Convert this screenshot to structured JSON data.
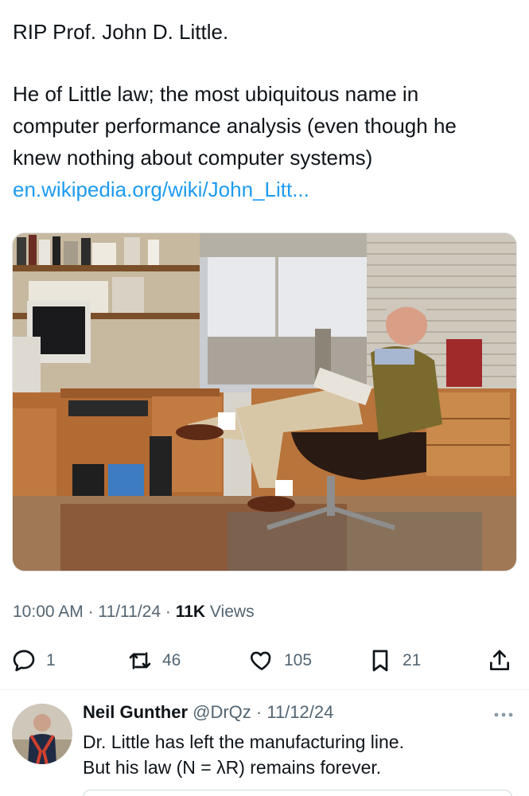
{
  "tweet": {
    "line1": "RIP Prof.  John D. Little.",
    "line2": "He of Little law; the most ubiquitous name in",
    "line3": "computer performance analysis (even though he",
    "line4": "knew nothing about computer systems)",
    "link": "en.wikipedia.org/wiki/John_Litt..."
  },
  "meta": {
    "time": "10:00 AM",
    "sep1": " · ",
    "date": "11/11/24",
    "sep2": " · ",
    "views_count": "11K",
    "views_label": " Views"
  },
  "actions": {
    "replies": "1",
    "reposts": "46",
    "likes": "105",
    "bookmarks": "21"
  },
  "reply": {
    "name": "Neil Gunther",
    "handle": " @DrQz · 11/12/24",
    "line1": "Dr. Little has left the manufacturing line.",
    "line2": "But his law (N = λR) remains forever."
  },
  "icons": {
    "reply": "comment-bubble-icon",
    "repost": "repost-arrows-icon",
    "like": "heart-icon",
    "bookmark": "bookmark-icon",
    "share": "share-upload-icon",
    "more": "more-dots-icon"
  },
  "colors": {
    "link": "#1d9bf0",
    "secondary_text": "#536471",
    "primary_text": "#0f1419"
  }
}
